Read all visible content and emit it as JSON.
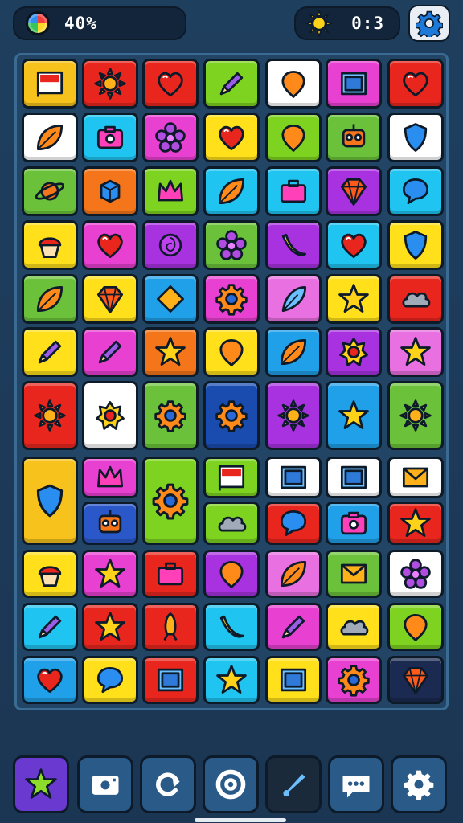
{
  "hud": {
    "progress_text": "40%",
    "progress_value": 0.4,
    "timer_text": "0:3",
    "left_icon": "rainbow-orb-icon",
    "right_icon": "sun-icon",
    "settings_icon": "gear-icon"
  },
  "colors": {
    "background": "#1f3f5f",
    "board": "#224566",
    "board_border": "#3b6a92"
  },
  "board": {
    "rows": [
      [
        {
          "color": "#f6c21b",
          "icon": "flag"
        },
        {
          "color": "#e8261e",
          "icon": "sun"
        },
        {
          "color": "#e8261e",
          "icon": "heart"
        },
        {
          "color": "#7ed321",
          "icon": "pencil"
        },
        {
          "color": "#ffffff",
          "icon": "balloon"
        },
        {
          "color": "#e840d0",
          "icon": "picture-frame"
        },
        {
          "color": "#e8261e",
          "icon": "heart"
        }
      ],
      [
        {
          "color": "#ffffff",
          "icon": "leaf"
        },
        {
          "color": "#20c4f0",
          "icon": "camera"
        },
        {
          "color": "#e840d0",
          "icon": "flower"
        },
        {
          "color": "#ffe01b",
          "icon": "heart"
        },
        {
          "color": "#7ed321",
          "icon": "balloon"
        },
        {
          "color": "#6bc23a",
          "icon": "robot"
        },
        {
          "color": "#ffffff",
          "icon": "shield"
        }
      ],
      [
        {
          "color": "#6bc23a",
          "icon": "planet"
        },
        {
          "color": "#f5761a",
          "icon": "cube"
        },
        {
          "color": "#7ed321",
          "icon": "crown"
        },
        {
          "color": "#20c4f0",
          "icon": "leaf"
        },
        {
          "color": "#20c4f0",
          "icon": "briefcase"
        },
        {
          "color": "#a832e0",
          "icon": "gem"
        },
        {
          "color": "#20c4f0",
          "icon": "speech"
        }
      ],
      [
        {
          "color": "#ffe01b",
          "icon": "cupcake"
        },
        {
          "color": "#e840d0",
          "icon": "heart"
        },
        {
          "color": "#a832e0",
          "icon": "rose"
        },
        {
          "color": "#6bc23a",
          "icon": "flower"
        },
        {
          "color": "#a832e0",
          "icon": "banana"
        },
        {
          "color": "#20c4f0",
          "icon": "heart"
        },
        {
          "color": "#ffe01b",
          "icon": "shield"
        }
      ],
      [
        {
          "color": "#6bc23a",
          "icon": "leaf"
        },
        {
          "color": "#ffe01b",
          "icon": "gem"
        },
        {
          "color": "#20a0e8",
          "icon": "diamond"
        },
        {
          "color": "#e840d0",
          "icon": "gear"
        },
        {
          "color": "#e870e0",
          "icon": "feather"
        },
        {
          "color": "#ffe01b",
          "icon": "star"
        },
        {
          "color": "#e8261e",
          "icon": "cloud"
        }
      ],
      [
        {
          "color": "#ffe01b",
          "icon": "pencil"
        },
        {
          "color": "#e840d0",
          "icon": "pencil"
        },
        {
          "color": "#f5761a",
          "icon": "star"
        },
        {
          "color": "#ffe01b",
          "icon": "balloon"
        },
        {
          "color": "#20a0e8",
          "icon": "leaf"
        },
        {
          "color": "#a832e0",
          "icon": "badge"
        },
        {
          "color": "#e870e0",
          "icon": "star"
        }
      ],
      [
        {
          "color": "#e8261e",
          "icon": "sun"
        },
        {
          "color": "#ffffff",
          "icon": "badge"
        },
        {
          "color": "#6bc23a",
          "icon": "gear"
        },
        {
          "color": "#1a4cb0",
          "icon": "gear"
        },
        {
          "color": "#a832e0",
          "icon": "sun"
        },
        {
          "color": "#20a0e8",
          "icon": "star"
        },
        {
          "color": "#6bc23a",
          "icon": "sun"
        }
      ]
    ],
    "block_section": {
      "col1_tall": {
        "color": "#f6c21b",
        "icon": "shield"
      },
      "col2_top": {
        "color": "#e840d0",
        "icon": "crown"
      },
      "col2_bottom": {
        "color": "#2a58c8",
        "icon": "robot"
      },
      "col3_tall": {
        "color": "#7ed321",
        "icon": "gear"
      },
      "col4_top": {
        "color": "#7ed321",
        "icon": "flag"
      },
      "col4_bottom": {
        "color": "#7ed321",
        "icon": "cloud"
      },
      "col5_top": {
        "color": "#ffffff",
        "icon": "picture-frame"
      },
      "col5_bottom": {
        "color": "#e8261e",
        "icon": "speech"
      },
      "col6_top": {
        "color": "#ffffff",
        "icon": "picture-frame"
      },
      "col6_bottom": {
        "color": "#20a0e8",
        "icon": "camera"
      },
      "col7_top": {
        "color": "#ffffff",
        "icon": "envelope"
      },
      "col7_bottom": {
        "color": "#e8261e",
        "icon": "star"
      }
    },
    "bottom_rows": [
      [
        {
          "color": "#ffe01b",
          "icon": "cupcake"
        },
        {
          "color": "#e840d0",
          "icon": "star"
        },
        {
          "color": "#e8261e",
          "icon": "briefcase"
        },
        {
          "color": "#a832e0",
          "icon": "balloon"
        },
        {
          "color": "#e870e0",
          "icon": "leaf"
        },
        {
          "color": "#6bc23a",
          "icon": "envelope"
        },
        {
          "color": "#ffffff",
          "icon": "flower"
        }
      ],
      [
        {
          "color": "#20c4f0",
          "icon": "pencil"
        },
        {
          "color": "#e8261e",
          "icon": "star"
        },
        {
          "color": "#e8261e",
          "icon": "rocket"
        },
        {
          "color": "#20c4f0",
          "icon": "banana"
        },
        {
          "color": "#e840d0",
          "icon": "pencil"
        },
        {
          "color": "#ffe01b",
          "icon": "cloud"
        },
        {
          "color": "#7ed321",
          "icon": "balloon"
        }
      ],
      [
        {
          "color": "#20a0e8",
          "icon": "heart"
        },
        {
          "color": "#ffe01b",
          "icon": "speech"
        },
        {
          "color": "#e8261e",
          "icon": "picture-frame"
        },
        {
          "color": "#20c4f0",
          "icon": "star"
        },
        {
          "color": "#ffe01b",
          "icon": "picture-frame"
        },
        {
          "color": "#e840d0",
          "icon": "gear"
        },
        {
          "color": "#1a2a50",
          "icon": "gem"
        }
      ]
    ]
  },
  "bottom_nav": [
    {
      "name": "nav-star",
      "icon": "star",
      "bg": "#6a3ad0"
    },
    {
      "name": "nav-camera",
      "icon": "camera",
      "bg": "#2a5a88"
    },
    {
      "name": "nav-refresh",
      "icon": "refresh",
      "bg": "#2a5a88"
    },
    {
      "name": "nav-target",
      "icon": "target",
      "bg": "#2a5a88"
    },
    {
      "name": "nav-brush",
      "icon": "brush",
      "bg": "#1a2a3a"
    },
    {
      "name": "nav-chat",
      "icon": "chat",
      "bg": "#2a5a88"
    },
    {
      "name": "nav-settings",
      "icon": "gear",
      "bg": "#2a5a88"
    }
  ]
}
